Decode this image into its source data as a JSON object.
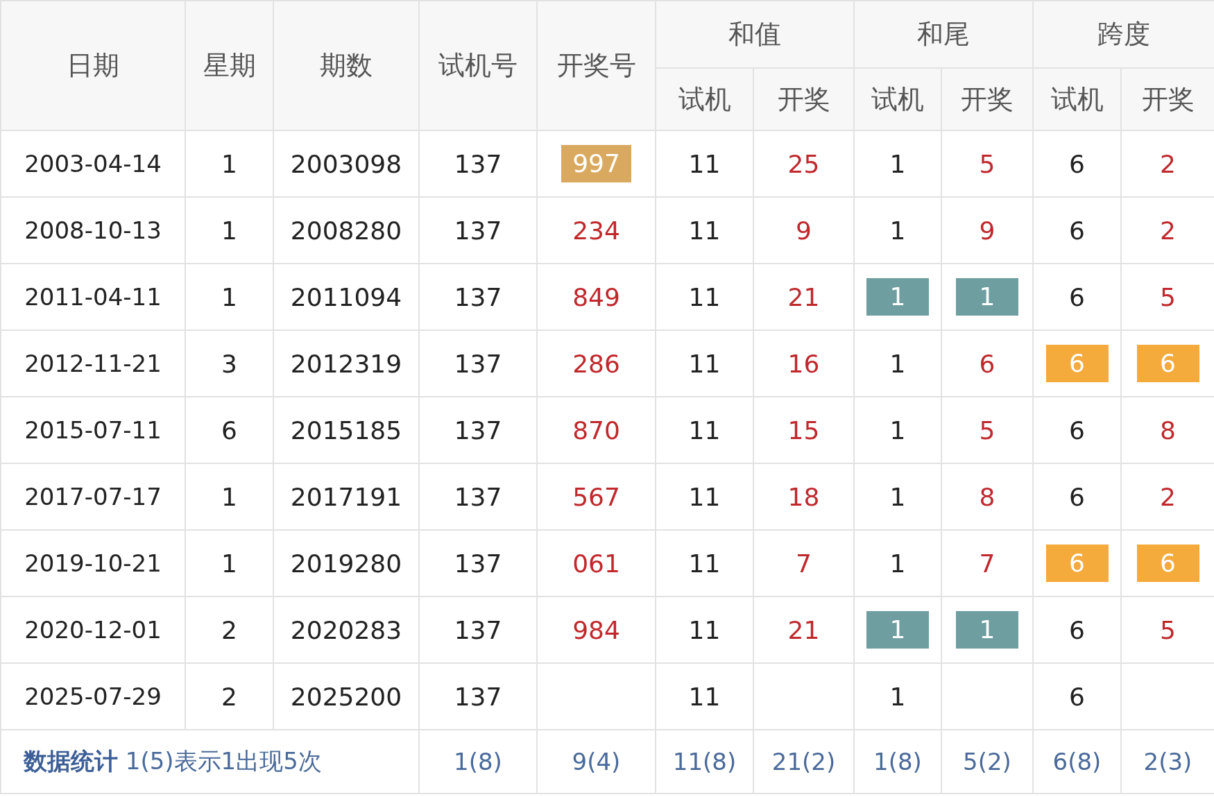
{
  "header": {
    "columns": [
      "日期",
      "星期",
      "期数",
      "试机号",
      "开奖号"
    ],
    "groups": [
      {
        "label": "和值",
        "sub": [
          "试机",
          "开奖"
        ]
      },
      {
        "label": "和尾",
        "sub": [
          "试机",
          "开奖"
        ]
      },
      {
        "label": "跨度",
        "sub": [
          "试机",
          "开奖"
        ]
      }
    ]
  },
  "rows": [
    {
      "cells": [
        {
          "text": "2003-04-14"
        },
        {
          "text": "1"
        },
        {
          "text": "2003098"
        },
        {
          "text": "137"
        },
        {
          "text": "997",
          "color": "#d9a95f"
        },
        {
          "text": "11"
        },
        {
          "text": "25"
        },
        {
          "text": "1"
        },
        {
          "text": "5"
        },
        {
          "text": "6"
        },
        {
          "text": "2"
        }
      ]
    },
    {
      "cells": [
        {
          "text": "2008-10-13"
        },
        {
          "text": "1"
        },
        {
          "text": "2008280"
        },
        {
          "text": "137"
        },
        {
          "text": "234"
        },
        {
          "text": "11"
        },
        {
          "text": "9"
        },
        {
          "text": "1"
        },
        {
          "text": "9"
        },
        {
          "text": "6"
        },
        {
          "text": "2"
        }
      ]
    },
    {
      "cells": [
        {
          "text": "2011-04-11"
        },
        {
          "text": "1"
        },
        {
          "text": "2011094"
        },
        {
          "text": "137"
        },
        {
          "text": "849"
        },
        {
          "text": "11"
        },
        {
          "text": "21"
        },
        {
          "text": "1",
          "color": "#6e9ea0"
        },
        {
          "text": "1",
          "color": "#6e9ea0"
        },
        {
          "text": "6"
        },
        {
          "text": "5"
        }
      ]
    },
    {
      "cells": [
        {
          "text": "2012-11-21"
        },
        {
          "text": "3"
        },
        {
          "text": "2012319"
        },
        {
          "text": "137"
        },
        {
          "text": "286"
        },
        {
          "text": "11"
        },
        {
          "text": "16"
        },
        {
          "text": "1"
        },
        {
          "text": "6"
        },
        {
          "text": "6",
          "color": "#f5aa3c"
        },
        {
          "text": "6",
          "color": "#f5aa3c"
        }
      ]
    },
    {
      "cells": [
        {
          "text": "2015-07-11"
        },
        {
          "text": "6"
        },
        {
          "text": "2015185"
        },
        {
          "text": "137"
        },
        {
          "text": "870"
        },
        {
          "text": "11"
        },
        {
          "text": "15"
        },
        {
          "text": "1"
        },
        {
          "text": "5"
        },
        {
          "text": "6"
        },
        {
          "text": "8"
        }
      ]
    },
    {
      "cells": [
        {
          "text": "2017-07-17"
        },
        {
          "text": "1"
        },
        {
          "text": "2017191"
        },
        {
          "text": "137"
        },
        {
          "text": "567"
        },
        {
          "text": "11"
        },
        {
          "text": "18"
        },
        {
          "text": "1"
        },
        {
          "text": "8"
        },
        {
          "text": "6"
        },
        {
          "text": "2"
        }
      ]
    },
    {
      "cells": [
        {
          "text": "2019-10-21"
        },
        {
          "text": "1"
        },
        {
          "text": "2019280"
        },
        {
          "text": "137"
        },
        {
          "text": "061"
        },
        {
          "text": "11"
        },
        {
          "text": "7"
        },
        {
          "text": "1"
        },
        {
          "text": "7"
        },
        {
          "text": "6",
          "color": "#f5aa3c"
        },
        {
          "text": "6",
          "color": "#f5aa3c"
        }
      ]
    },
    {
      "cells": [
        {
          "text": "2020-12-01"
        },
        {
          "text": "2"
        },
        {
          "text": "2020283"
        },
        {
          "text": "137"
        },
        {
          "text": "984"
        },
        {
          "text": "11"
        },
        {
          "text": "21"
        },
        {
          "text": "1",
          "color": "#6e9ea0"
        },
        {
          "text": "1",
          "color": "#6e9ea0"
        },
        {
          "text": "6"
        },
        {
          "text": "5"
        }
      ]
    },
    {
      "cells": [
        {
          "text": "2025-07-29"
        },
        {
          "text": "2"
        },
        {
          "text": "2025200"
        },
        {
          "text": "137"
        },
        {
          "text": ""
        },
        {
          "text": "11"
        },
        {
          "text": ""
        },
        {
          "text": "1"
        },
        {
          "text": ""
        },
        {
          "text": "6"
        },
        {
          "text": ""
        }
      ]
    }
  ],
  "footer": {
    "note": "**数据统计** 1(5)表示1出现5次",
    "stats": [
      "1(8)",
      "9(4)",
      "11(8)",
      "21(2)",
      "1(8)",
      "5(2)",
      "6(8)",
      "2(3)"
    ]
  }
}
